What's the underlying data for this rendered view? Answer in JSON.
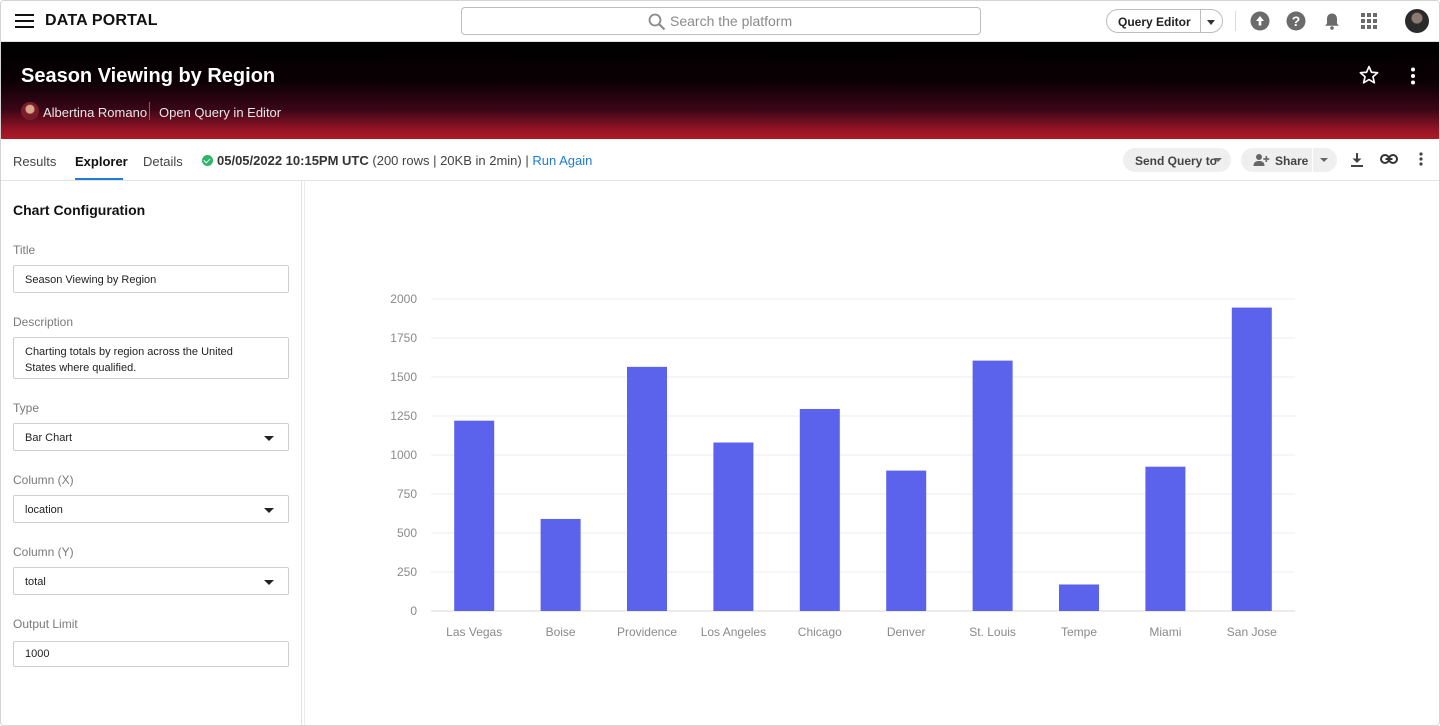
{
  "topbar": {
    "brand": "DATA PORTAL",
    "search_placeholder": "Search the platform",
    "query_editor_label": "Query Editor"
  },
  "banner": {
    "title": "Season Viewing by Region",
    "user_name": "Albertina Romano",
    "open_query_label": "Open Query in Editor"
  },
  "tabs": [
    {
      "label": "Results",
      "active": false
    },
    {
      "label": "Explorer",
      "active": true
    },
    {
      "label": "Details",
      "active": false
    }
  ],
  "status": {
    "timestamp": "05/05/2022 10:15PM UTC",
    "info": "(200 rows | 20KB in 2min) |",
    "run_again": "Run Again"
  },
  "toolbar": {
    "send_query_label": "Send Query to",
    "share_label": "Share"
  },
  "config": {
    "heading": "Chart Configuration",
    "title_label": "Title",
    "title_value": "Season Viewing by Region",
    "description_label": "Description",
    "description_value": "Charting totals by region across the United States where qualified.",
    "type_label": "Type",
    "type_value": "Bar Chart",
    "column_x_label": "Column (X)",
    "column_x_value": "location",
    "column_y_label": "Column (Y)",
    "column_y_value": "total",
    "output_limit_label": "Output Limit",
    "output_limit_value": "1000"
  },
  "colors": {
    "bar": "#5b63ec",
    "accent": "#1f7bd8",
    "status_ok": "#2fb36b"
  },
  "chart_data": {
    "type": "bar",
    "categories": [
      "Las Vegas",
      "Boise",
      "Providence",
      "Los Angeles",
      "Chicago",
      "Denver",
      "St. Louis",
      "Tempe",
      "Miami",
      "San Jose"
    ],
    "values": [
      1220,
      590,
      1565,
      1080,
      1295,
      900,
      1605,
      170,
      925,
      1945
    ],
    "ylim": [
      0,
      2000
    ],
    "yticks": [
      0,
      250,
      500,
      750,
      1000,
      1250,
      1500,
      1750,
      2000
    ],
    "grid": true,
    "legend": false
  }
}
